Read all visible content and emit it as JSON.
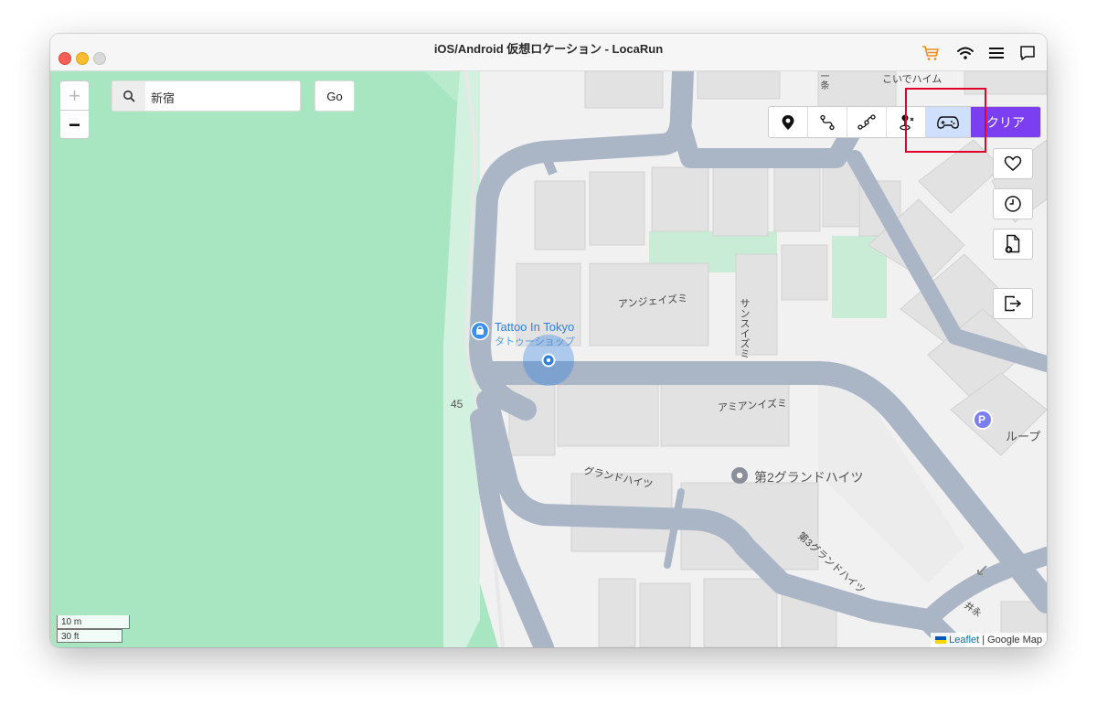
{
  "window": {
    "title": "iOS/Android 仮想ロケーション - LocaRun"
  },
  "titlebar_icons": [
    "cart-icon",
    "wifi-icon",
    "menu-icon",
    "chat-icon"
  ],
  "colors": {
    "park": "#a8e6c1",
    "road": "#aab5c6",
    "building": "#e3e3e3",
    "accent": "#7b3ef0",
    "active_mode": "#cfe0ff",
    "highlight": "#e3002a",
    "location_dot": "#2f7fe0"
  },
  "zoom": {
    "in_label": "+",
    "out_label": "−"
  },
  "search": {
    "value": "新宿",
    "go_label": "Go"
  },
  "modes": [
    {
      "name": "teleport-mode",
      "icon": "pin-icon"
    },
    {
      "name": "two-spot-mode",
      "icon": "route-icon"
    },
    {
      "name": "multi-spot-mode",
      "icon": "multi-route-icon"
    },
    {
      "name": "jump-mode",
      "icon": "joystick-pin-icon"
    },
    {
      "name": "joystick-mode",
      "icon": "gamepad-icon",
      "active": true
    }
  ],
  "clear_label": "クリア",
  "side_buttons": [
    "heart-icon",
    "clock-icon",
    "file-import-icon",
    "exit-icon"
  ],
  "map": {
    "poi": {
      "name": "Tattoo In Tokyo",
      "category": "タトゥーショップ"
    },
    "labels": {
      "koide": "こいでハイム",
      "anje": "アンジェイズミ",
      "sans": "サンスイズミ",
      "amian": "アミアンイズミ",
      "grand": "グランドハイツ",
      "grand2": "第2グランドハイツ",
      "grand3": "第3グランドハイツ",
      "loop": "ループ",
      "road45": "45",
      "kanji1": "一条",
      "kanji2": "井永"
    },
    "parking": "P"
  },
  "scale": {
    "metric": "10 m",
    "imperial": "30 ft"
  },
  "attribution": {
    "leaflet": "Leaflet",
    "separator": "|",
    "provider": "Google Map"
  }
}
